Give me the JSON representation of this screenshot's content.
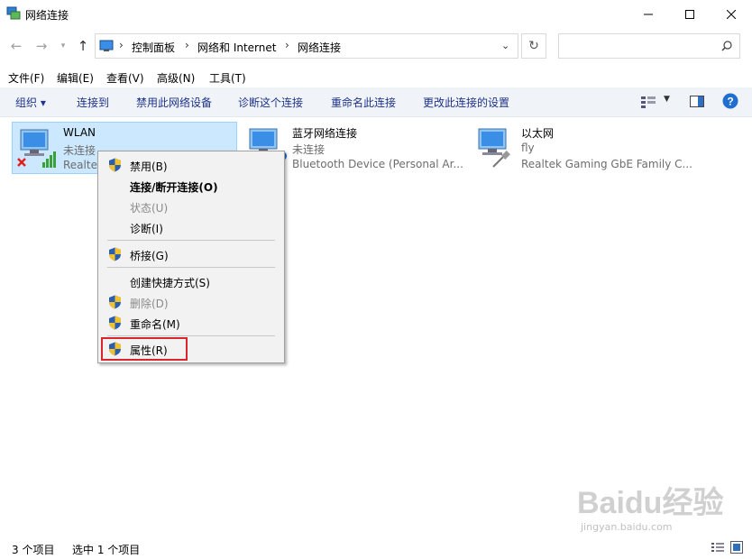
{
  "window": {
    "title": "网络连接"
  },
  "address": {
    "breadcrumbs": [
      "控制面板",
      "网络和 Internet",
      "网络连接"
    ],
    "search_placeholder": ""
  },
  "menubar": [
    "文件(F)",
    "编辑(E)",
    "查看(V)",
    "高级(N)",
    "工具(T)"
  ],
  "toolbar": [
    "组织 ▾",
    "连接到",
    "禁用此网络设备",
    "诊断这个连接",
    "重命名此连接",
    "更改此连接的设置"
  ],
  "connections": [
    {
      "name": "WLAN",
      "status": "未连接",
      "device": "Realtek",
      "selected": true
    },
    {
      "name": "蓝牙网络连接",
      "status": "未连接",
      "device": "Bluetooth Device (Personal Ar...",
      "selected": false
    },
    {
      "name": "以太网",
      "status": "fly",
      "device": "Realtek Gaming GbE Family C...",
      "selected": false
    }
  ],
  "context_menu": {
    "items": [
      {
        "label": "禁用(B)",
        "shield": true
      },
      {
        "label": "连接/断开连接(O)",
        "bold": true
      },
      {
        "label": "状态(U)",
        "disabled": true
      },
      {
        "label": "诊断(I)"
      },
      {
        "label": "桥接(G)",
        "shield": true
      },
      {
        "label": "创建快捷方式(S)"
      },
      {
        "label": "删除(D)",
        "shield": true,
        "disabled": true
      },
      {
        "label": "重命名(M)",
        "shield": true
      },
      {
        "label": "属性(R)",
        "shield": true,
        "highlighted": true
      }
    ]
  },
  "status": {
    "count": "3 个项目",
    "selected": "选中 1 个项目"
  },
  "watermark": {
    "text": "Baidu经验",
    "url": "jingyan.baidu.com"
  },
  "colors": {
    "command_text": "#1e3287",
    "selection": "#cce8ff",
    "highlight_box": "#d9262c"
  }
}
